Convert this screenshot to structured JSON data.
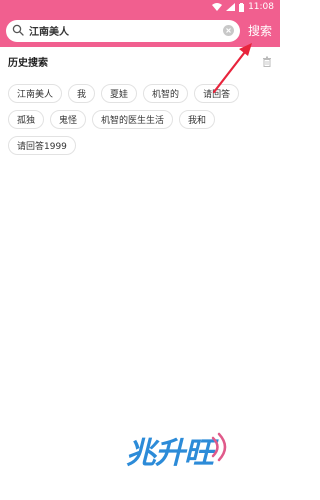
{
  "status_bar": {
    "time": "11:08"
  },
  "search": {
    "value": "江南美人",
    "button_label": "搜索"
  },
  "history": {
    "title": "历史搜索",
    "items": [
      "江南美人",
      "我",
      "夏娃",
      "机智的",
      "请回答",
      "孤独",
      "鬼怪",
      "机智的医生生活",
      "我和",
      "请回答1999"
    ]
  },
  "watermark": {
    "text": "兆升旺"
  },
  "colors": {
    "accent": "#f15f8f",
    "annotation_arrow": "#e8243c",
    "watermark": "#2c8bd8"
  }
}
